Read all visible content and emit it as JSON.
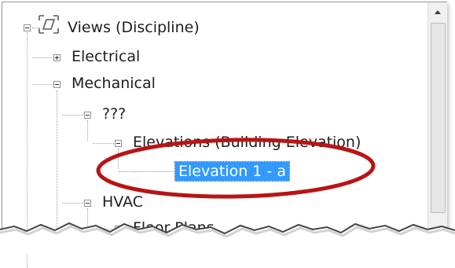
{
  "tree": {
    "root": {
      "label": "Views (Discipline)",
      "icon": "views-icon",
      "expanded": true
    },
    "electrical": {
      "label": "Electrical",
      "expanded": false
    },
    "mechanical": {
      "label": "Mechanical",
      "expanded": true
    },
    "unknown": {
      "label": "???",
      "expanded": true
    },
    "elevations": {
      "label": "Elevations (Building Elevation)",
      "expanded": true
    },
    "elevation_1a": {
      "label": "Elevation 1 - a",
      "selected": true
    },
    "hvac": {
      "label": "HVAC",
      "expanded": true
    },
    "floor_plans": {
      "label": "Floor Plans",
      "expanded": true
    }
  },
  "colors": {
    "selection": "#3399ff",
    "annotation": "#b81414"
  }
}
